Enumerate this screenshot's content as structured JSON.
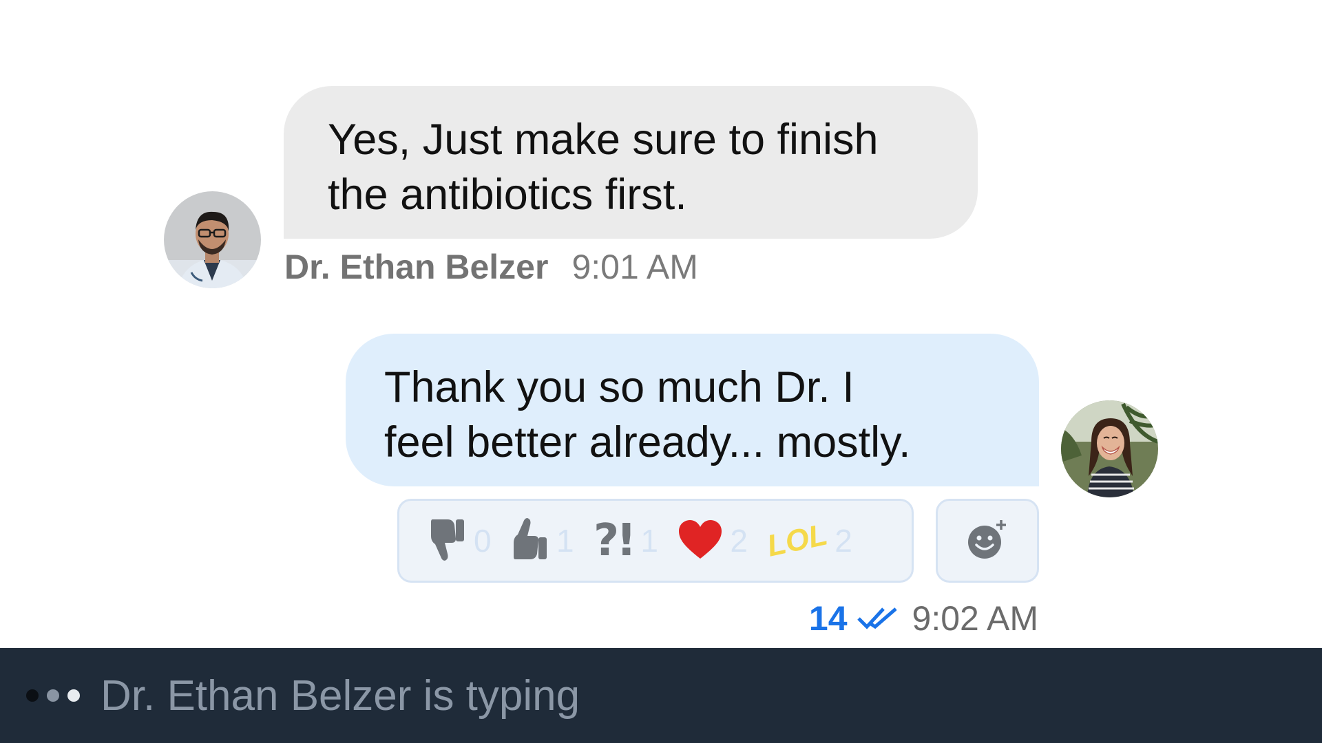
{
  "messages": {
    "incoming": {
      "line1": "Yes, Just make sure to finish",
      "line2": "the antibiotics first.",
      "sender": "Dr. Ethan Belzer",
      "time": "9:01 AM",
      "bubble_color": "#ebebeb"
    },
    "outgoing": {
      "line1": "Thank you so much Dr. I",
      "line2": "feel better already... mostly.",
      "read_count": "14",
      "time": "9:02 AM",
      "bubble_color": "#dfeefc"
    }
  },
  "reactions": [
    {
      "icon": "thumbs-down-icon",
      "count": "0"
    },
    {
      "icon": "thumbs-up-icon",
      "count": "1"
    },
    {
      "icon": "interrobang-icon",
      "label": "?!",
      "count": "1"
    },
    {
      "icon": "heart-icon",
      "count": "2"
    },
    {
      "icon": "lol-icon",
      "label": "LOL",
      "count": "2"
    }
  ],
  "add_reaction_icon": "add-emoji-icon",
  "typing": {
    "text": "Dr. Ethan Belzer is typing",
    "bar_color": "#1f2b39"
  },
  "colors": {
    "accent": "#1a73e8",
    "heart": "#e02424",
    "lol": "#f5d94a"
  }
}
